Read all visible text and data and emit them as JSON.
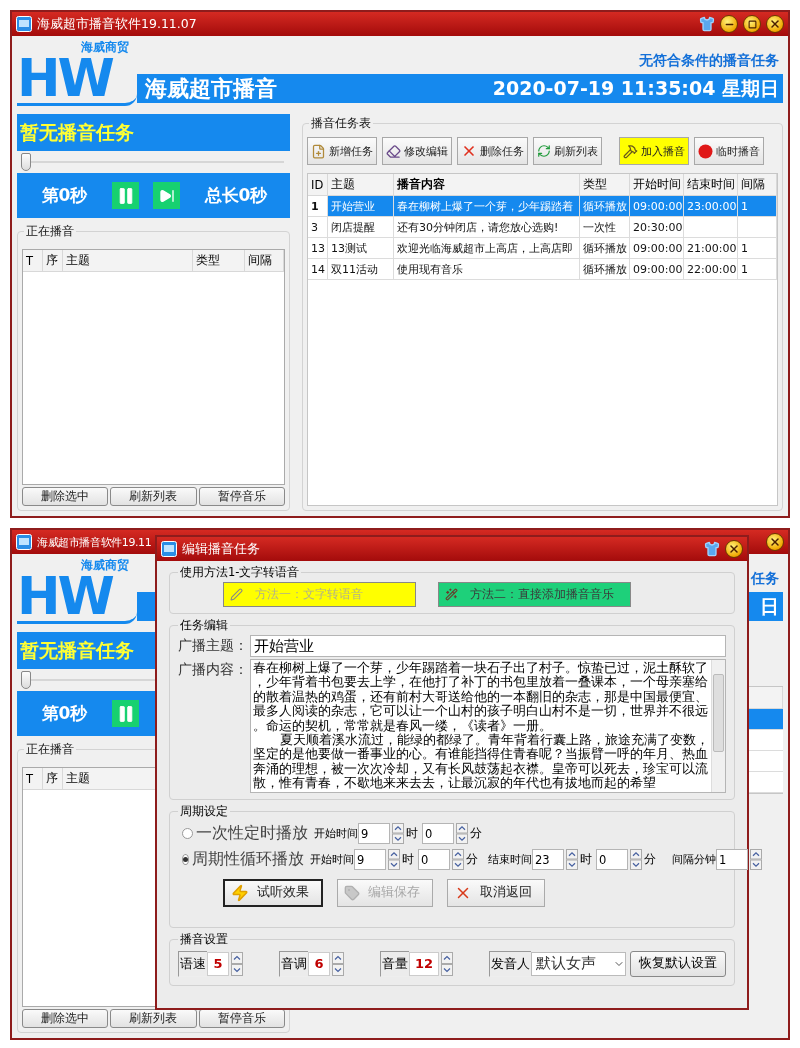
{
  "main_window": {
    "title": "海威超市播音软件19.11.07",
    "logo": {
      "letters": "HW",
      "tagline": "海威商贸"
    },
    "status": "无符合条件的播音任务",
    "app_name": "海威超市播音",
    "datetime": "2020-07-19 11:35:04 星期日",
    "now_playing": "暂无播音任务",
    "progress": {
      "level": 0
    },
    "position": "第0秒",
    "controls": [
      {
        "kind": "pause"
      },
      {
        "kind": "next"
      }
    ],
    "duration": "总长0秒",
    "playing_list": {
      "title": "正在播音",
      "columns": [
        "T",
        "序",
        "主题",
        "类型",
        "间隔"
      ]
    },
    "list_buttons": [
      "删除选中",
      "刷新列表",
      "暂停音乐"
    ],
    "task_table": {
      "title": "播音任务表",
      "toolbar": [
        {
          "label": "新增任务",
          "kind": "add"
        },
        {
          "label": "修改编辑",
          "kind": "edit"
        },
        {
          "label": "删除任务",
          "kind": "delete"
        },
        {
          "label": "刷新列表",
          "kind": "refresh"
        },
        {
          "label": "加入播音",
          "kind": "enqueue"
        },
        {
          "label": "临时播音",
          "kind": "record"
        }
      ],
      "columns": [
        {
          "label": "ID",
          "emphasized": false
        },
        {
          "label": "主题",
          "emphasized": false
        },
        {
          "label": "播音内容",
          "emphasized": true
        },
        {
          "label": "类型",
          "emphasized": false
        },
        {
          "label": "开始时间",
          "emphasized": false
        },
        {
          "label": "结束时间",
          "emphasized": false
        },
        {
          "label": "间隔",
          "emphasized": false
        }
      ],
      "rows": [
        {
          "selected": true,
          "cells": [
            "1",
            "开始营业",
            "春在柳树上爆了一个芽，少年踢踏着",
            "循环播放",
            "09:00:00",
            "23:00:00",
            "1"
          ]
        },
        {
          "selected": false,
          "cells": [
            "3",
            "闭店提醒",
            "还有30分钟闭店，请您放心选购!",
            "一次性",
            "20:30:00",
            null,
            null
          ]
        },
        {
          "selected": false,
          "cells": [
            "13",
            "13测试",
            "欢迎光临海威超市上高店，上高店即",
            "循环播放",
            "09:00:00",
            "21:00:00",
            "1"
          ]
        },
        {
          "selected": false,
          "cells": [
            "14",
            "双11活动",
            "使用现有音乐",
            "循环播放",
            "09:00:00",
            "22:00:00",
            "1"
          ]
        }
      ]
    }
  },
  "background_window": {
    "title": "海威超市播音软件19.11",
    "logo": {
      "letters": "HW",
      "tagline": "海威商贸"
    },
    "status": "任务",
    "datetime": "日",
    "now_playing": "暂无播音任务",
    "progress": {
      "level": 0
    },
    "position": "第0秒",
    "controls": [
      {
        "kind": "pause"
      }
    ],
    "playing_list": {
      "title": "正在播音",
      "columns": [
        "T",
        "序",
        "主题"
      ]
    },
    "list_buttons": [
      "删除选中",
      "刷新列表",
      "暂停音乐"
    ],
    "task_table_fragment": {
      "rows": [
        {
          "selected": true
        },
        {
          "selected": false
        },
        {
          "selected": false
        },
        {
          "selected": false
        }
      ]
    }
  },
  "edit_dialog": {
    "title": "编辑播音任务",
    "method_group": {
      "title": "使用方法1-文字转语音",
      "buttons": [
        {
          "label": "方法一：文字转语音",
          "kind": "tts",
          "disabled": true
        },
        {
          "label": "方法二：直接添加播音音乐",
          "kind": "music",
          "disabled": false
        }
      ]
    },
    "edit_group": {
      "title": "任务编辑",
      "subject_label": "广播主题：",
      "subject": "开始营业",
      "content_label": "广播内容：",
      "content": [
        "春在柳树上爆了一个芽，少年踢踏着一块石子出了村子。惊蛰已过，泥土酥软了，少年背着书包要去上学，在他打了补丁的书包里放着一叠课本，一个母亲塞给的散着温热的鸡蛋，还有前村大哥送给他的一本翻旧的杂志，那是中国最便宜、最多人阅读的杂志，它可以让一个山村的孩子明白山村不是一切，世界并不很远。命运的契机，常常就是春风一缕，《读者》一册。",
        "夏天顺着溪水流过，能绿的都绿了。青年背着行囊上路，旅途充满了变数，坚定的是他要做一番事业的心。有谁能挡得住青春呢？当振臂一呼的年月、热血奔涌的理想，被一次次冷却，又有长风鼓荡起衣襟。皇帝可以死去，珍宝可以流散，惟有青春，不歇地来来去去，让最沉寂的年代也有拔地而起的希望"
      ]
    },
    "schedule_group": {
      "title": "周期设定",
      "modes": [
        {
          "label": "一次性定时播放",
          "selected": false,
          "fields": [
            {
              "label": "开始时间",
              "value": "9",
              "unit": "时"
            },
            {
              "value": "0",
              "unit": "分"
            }
          ]
        },
        {
          "label": "周期性循环播放",
          "selected": true,
          "fields": [
            {
              "label": "开始时间",
              "value": "9",
              "unit": "时"
            },
            {
              "value": "0",
              "unit": "分"
            },
            {
              "label": "结束时间",
              "value": "23",
              "unit": "时"
            },
            {
              "value": "0",
              "unit": "分"
            },
            {
              "label": "间隔分钟",
              "value": "1"
            }
          ]
        }
      ],
      "buttons": [
        {
          "label": "试听效果",
          "kind": "preview",
          "disabled": false,
          "focused": true
        },
        {
          "label": "编辑保存",
          "kind": "save",
          "disabled": true,
          "focused": false
        },
        {
          "label": "取消返回",
          "kind": "cancel",
          "disabled": false,
          "focused": false
        }
      ]
    },
    "voice_group": {
      "title": "播音设置",
      "fields": [
        {
          "label": "语速",
          "value": "5"
        },
        {
          "label": "音调",
          "value": "6"
        },
        {
          "label": "音量",
          "value": "12"
        }
      ],
      "speaker": {
        "label": "发音人",
        "value": "默认女声"
      },
      "reset": "恢复默认设置"
    }
  }
}
